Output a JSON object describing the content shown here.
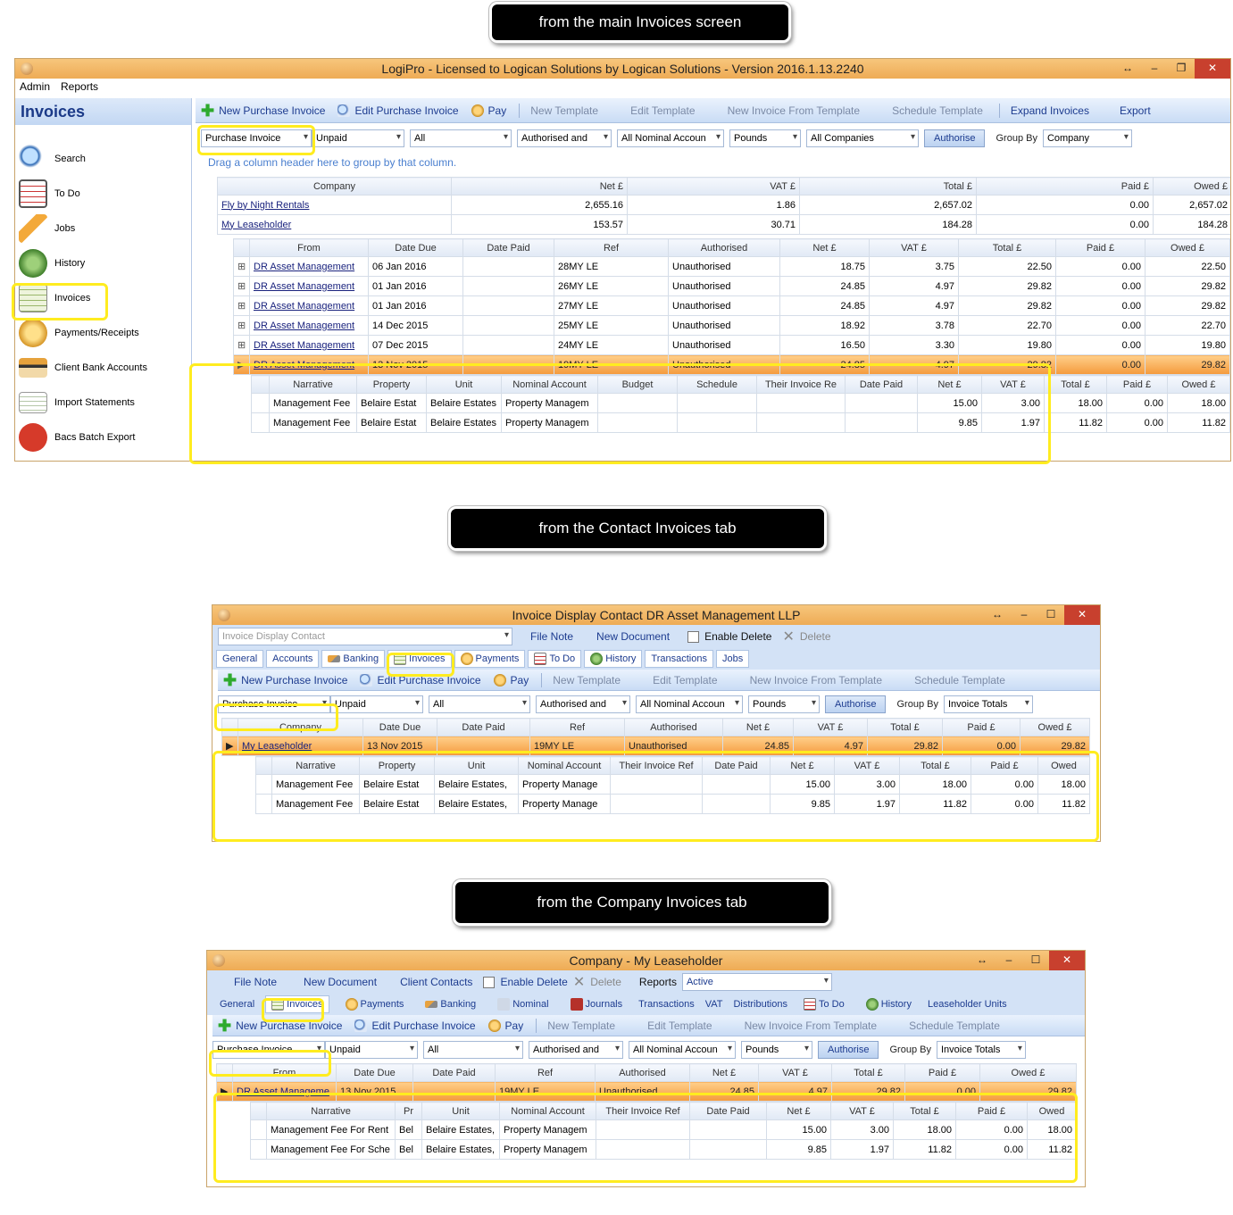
{
  "callouts": {
    "main": "from the main Invoices screen",
    "contact": "from the Contact Invoices tab",
    "company": "from the Company Invoices tab"
  },
  "main": {
    "title": "LogiPro - Licensed to Logican Solutions by Logican Solutions - Version 2016.1.13.2240",
    "menu": [
      "Admin",
      "Reports"
    ],
    "sidebar": {
      "title": "Invoices",
      "items": [
        "Search",
        "To Do",
        "Jobs",
        "History",
        "Invoices",
        "Payments/Receipts",
        "Client Bank Accounts",
        "Import Statements",
        "Bacs Batch Export"
      ]
    },
    "toolbar": [
      "New Purchase Invoice",
      "Edit Purchase Invoice",
      "Pay",
      "New  Template",
      "Edit Template",
      "New Invoice From Template",
      "Schedule Template",
      "Expand Invoices",
      "Export"
    ],
    "filters": [
      "Purchase Invoice",
      "Unpaid",
      "All",
      "Authorised and",
      "All Nominal Accoun",
      "Pounds",
      "All Companies"
    ],
    "authorise": "Authorise",
    "group_by_label": "Group By",
    "group_by": "Company",
    "drag_hint": "Drag a column header here to group by that column.",
    "company_cols": [
      "Company",
      "Net £",
      "VAT £",
      "Total £",
      "Paid £",
      "Owed £"
    ],
    "companies": [
      [
        "Fly by Night Rentals",
        "2,655.16",
        "1.86",
        "2,657.02",
        "0.00",
        "2,657.02"
      ],
      [
        "My Leaseholder",
        "153.57",
        "30.71",
        "184.28",
        "0.00",
        "184.28"
      ]
    ],
    "inv_cols": [
      "From",
      "Date Due",
      "Date Paid",
      "Ref",
      "Authorised",
      "Net £",
      "VAT £",
      "Total £",
      "Paid £",
      "Owed £"
    ],
    "invoices": [
      [
        "DR Asset Management",
        "06 Jan 2016",
        "",
        "28MY LE",
        "Unauthorised",
        "18.75",
        "3.75",
        "22.50",
        "0.00",
        "22.50"
      ],
      [
        "DR Asset Management",
        "01 Jan 2016",
        "",
        "26MY LE",
        "Unauthorised",
        "24.85",
        "4.97",
        "29.82",
        "0.00",
        "29.82"
      ],
      [
        "DR Asset Management",
        "01 Jan 2016",
        "",
        "27MY LE",
        "Unauthorised",
        "24.85",
        "4.97",
        "29.82",
        "0.00",
        "29.82"
      ],
      [
        "DR Asset Management",
        "14 Dec 2015",
        "",
        "25MY LE",
        "Unauthorised",
        "18.92",
        "3.78",
        "22.70",
        "0.00",
        "22.70"
      ],
      [
        "DR Asset Management",
        "07 Dec 2015",
        "",
        "24MY LE",
        "Unauthorised",
        "16.50",
        "3.30",
        "19.80",
        "0.00",
        "19.80"
      ],
      [
        "DR Asset Management",
        "13 Nov 2015",
        "",
        "19MY LE",
        "Unauthorised",
        "24.85",
        "4.97",
        "29.82",
        "0.00",
        "29.82"
      ]
    ],
    "line_cols": [
      "Narrative",
      "Property",
      "Unit",
      "Nominal Account",
      "Budget",
      "Schedule",
      "Their Invoice Re",
      "Date Paid",
      "Net £",
      "VAT £",
      "Total £",
      "Paid £",
      "Owed £"
    ],
    "lines": [
      [
        "Management Fee",
        "Belaire Estat",
        "Belaire Estates",
        "Property Managem",
        "",
        "",
        "",
        "",
        "15.00",
        "3.00",
        "18.00",
        "0.00",
        "18.00"
      ],
      [
        "Management Fee",
        "Belaire Estat",
        "Belaire Estates",
        "Property Managem",
        "",
        "",
        "",
        "",
        "9.85",
        "1.97",
        "11.82",
        "0.00",
        "11.82"
      ]
    ]
  },
  "contact": {
    "title": "Invoice Display Contact DR Asset Management LLP",
    "top": {
      "combo": "Invoice Display Contact",
      "file_note": "File Note",
      "new_doc": "New Document",
      "enable_delete": "Enable Delete",
      "delete": "Delete"
    },
    "tabs": [
      "General",
      "Accounts",
      "Banking",
      "Invoices",
      "Payments",
      "To Do",
      "History",
      "Transactions",
      "Jobs"
    ],
    "toolbar": [
      "New Purchase Invoice",
      "Edit Purchase Invoice",
      "Pay",
      "New  Template",
      "Edit Template",
      "New Invoice From Template",
      "Schedule Template"
    ],
    "filters": [
      "Purchase Invoice",
      "Unpaid",
      "All",
      "Authorised and",
      "All Nominal Accoun",
      "Pounds"
    ],
    "authorise": "Authorise",
    "group_by_label": "Group By",
    "group_by": "Invoice Totals",
    "inv_cols": [
      "Company",
      "Date Due",
      "Date Paid",
      "Ref",
      "Authorised",
      "Net £",
      "VAT £",
      "Total £",
      "Paid £",
      "Owed £"
    ],
    "invoice": [
      "My Leaseholder",
      "13 Nov 2015",
      "",
      "19MY LE",
      "Unauthorised",
      "24.85",
      "4.97",
      "29.82",
      "0.00",
      "29.82"
    ],
    "line_cols": [
      "Narrative",
      "Property",
      "Unit",
      "Nominal Account",
      "Their Invoice Ref",
      "Date Paid",
      "Net £",
      "VAT £",
      "Total £",
      "Paid £",
      "Owed"
    ],
    "lines": [
      [
        "Management Fee",
        "Belaire Estat",
        "Belaire Estates,",
        "Property Manage",
        "",
        "",
        "15.00",
        "3.00",
        "18.00",
        "0.00",
        "18.00"
      ],
      [
        "Management Fee",
        "Belaire Estat",
        "Belaire Estates,",
        "Property Manage",
        "",
        "",
        "9.85",
        "1.97",
        "11.82",
        "0.00",
        "11.82"
      ]
    ]
  },
  "company": {
    "title": "Company - My Leaseholder",
    "top": {
      "file_note": "File Note",
      "new_doc": "New Document",
      "client_contacts": "Client Contacts",
      "enable_delete": "Enable Delete",
      "delete": "Delete",
      "reports": "Reports",
      "status": "Active"
    },
    "tabs": [
      "General",
      "Invoices",
      "Payments",
      "Banking",
      "Nominal",
      "Journals",
      "Transactions",
      "VAT",
      "Distributions",
      "To Do",
      "History",
      "Leaseholder Units"
    ],
    "toolbar": [
      "New Purchase Invoice",
      "Edit Purchase Invoice",
      "Pay",
      "New  Template",
      "Edit Template",
      "New Invoice From Template",
      "Schedule Template"
    ],
    "filters": [
      "Purchase Invoice",
      "Unpaid",
      "All",
      "Authorised and",
      "All Nominal Accoun",
      "Pounds"
    ],
    "authorise": "Authorise",
    "group_by_label": "Group By",
    "group_by": "Invoice Totals",
    "inv_cols": [
      "From",
      "Date Due",
      "Date Paid",
      "Ref",
      "Authorised",
      "Net £",
      "VAT £",
      "Total £",
      "Paid £",
      "Owed £"
    ],
    "invoice": [
      "DR Asset Manageme",
      "13 Nov 2015",
      "",
      "19MY LE",
      "Unauthorised",
      "24.85",
      "4.97",
      "29.82",
      "0.00",
      "29.82"
    ],
    "line_cols": [
      "Narrative",
      "Pr",
      "Unit",
      "Nominal Account",
      "Their Invoice Ref",
      "Date Paid",
      "Net £",
      "VAT £",
      "Total £",
      "Paid £",
      "Owed"
    ],
    "lines": [
      [
        "Management Fee For Rent",
        "Bel",
        "Belaire Estates,",
        "Property Managem",
        "",
        "",
        "15.00",
        "3.00",
        "18.00",
        "0.00",
        "18.00"
      ],
      [
        "Management Fee For Sche",
        "Bel",
        "Belaire Estates,",
        "Property Managem",
        "",
        "",
        "9.85",
        "1.97",
        "11.82",
        "0.00",
        "11.82"
      ]
    ]
  }
}
